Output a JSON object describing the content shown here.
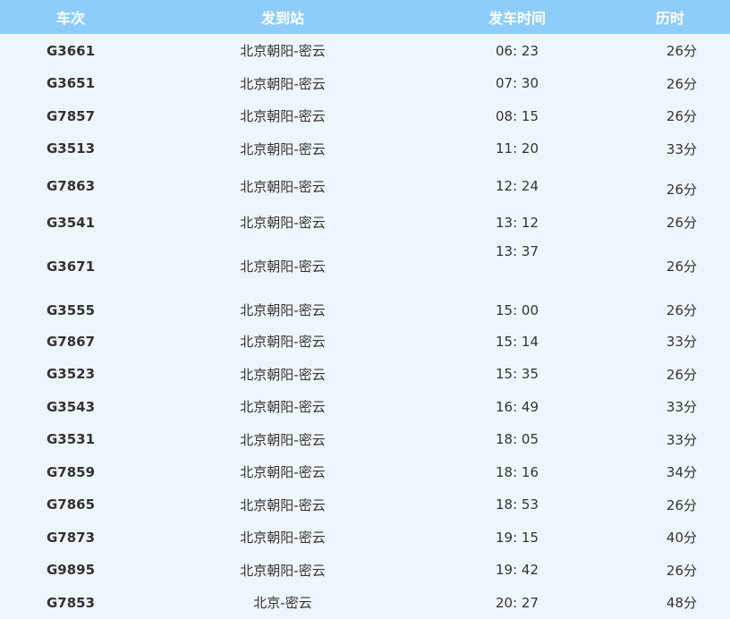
{
  "header": {
    "train": "车次",
    "station": "发到站",
    "departure": "发车时间",
    "duration": "历时"
  },
  "rows": [
    {
      "train": "G3661",
      "station": "北京朝阳-密云",
      "time": "06: 23",
      "duration": "26分"
    },
    {
      "train": "G3651",
      "station": "北京朝阳-密云",
      "time": "07: 30",
      "duration": "26分"
    },
    {
      "train": "G7857",
      "station": "北京朝阳-密云",
      "time": "08: 15",
      "duration": "26分"
    },
    {
      "train": "G3513",
      "station": "北京朝阳-密云",
      "time": "11: 20",
      "duration": "33分"
    },
    {
      "train": "G7863",
      "station": "北京朝阳-密云",
      "time": "12: 24",
      "duration": "26分"
    },
    {
      "train": "G3541",
      "station": "北京朝阳-密云",
      "time": "13: 12",
      "duration": "26分"
    },
    {
      "train": "G3671",
      "station": "北京朝阳-密云",
      "time": "13: 37",
      "duration": "26分"
    },
    {
      "train": "G3555",
      "station": "北京朝阳-密云",
      "time": "15: 00",
      "duration": "26分"
    },
    {
      "train": "G7867",
      "station": "北京朝阳-密云",
      "time": "15: 14",
      "duration": "33分"
    },
    {
      "train": "G3523",
      "station": "北京朝阳-密云",
      "time": "15: 35",
      "duration": "26分"
    },
    {
      "train": "G3543",
      "station": "北京朝阳-密云",
      "time": "16: 49",
      "duration": "33分"
    },
    {
      "train": "G3531",
      "station": "北京朝阳-密云",
      "time": "18: 05",
      "duration": "33分"
    },
    {
      "train": "G7859",
      "station": "北京朝阳-密云",
      "time": "18: 16",
      "duration": "34分"
    },
    {
      "train": "G7865",
      "station": "北京朝阳-密云",
      "time": "18: 53",
      "duration": "26分"
    },
    {
      "train": "G7873",
      "station": "北京朝阳-密云",
      "time": "19: 15",
      "duration": "40分"
    },
    {
      "train": "G9895",
      "station": "北京朝阳-密云",
      "time": "19: 42",
      "duration": "26分"
    },
    {
      "train": "G7853",
      "station": "北京-密云",
      "time": "20: 27",
      "duration": "48分"
    }
  ],
  "colors": {
    "header_bg": "#8ecdfb",
    "body_bg": "#eef6fd",
    "text": "#333333"
  }
}
